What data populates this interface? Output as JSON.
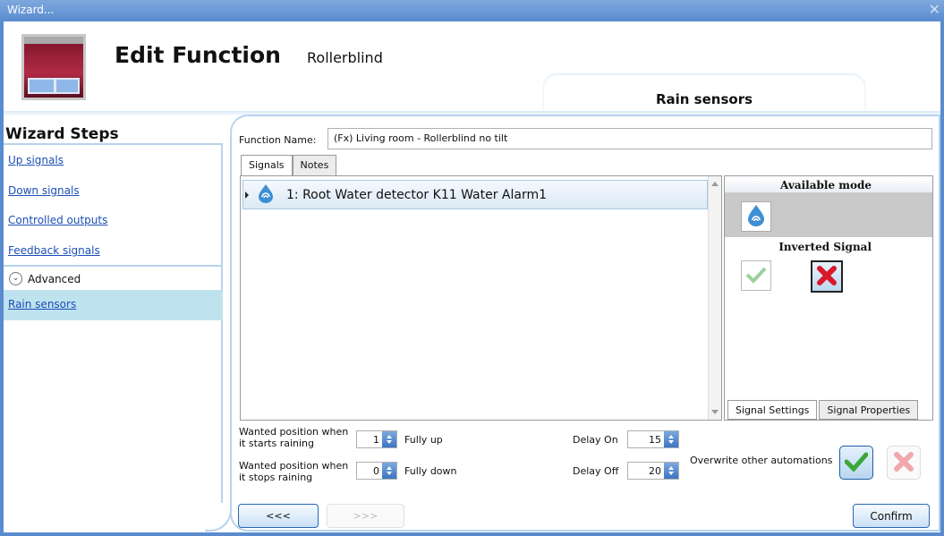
{
  "window": {
    "title": "Wizard...",
    "close_glyph": "✕"
  },
  "header": {
    "title": "Edit Function",
    "subtitle": "Rollerblind",
    "step_title": "Rain sensors"
  },
  "sidebar": {
    "heading": "Wizard Steps",
    "items": [
      {
        "label": "Up signals"
      },
      {
        "label": "Down signals"
      },
      {
        "label": "Controlled outputs"
      },
      {
        "label": "Feedback signals"
      }
    ],
    "advanced_label": "Advanced",
    "selected_item": "Rain sensors"
  },
  "form": {
    "function_name_label": "Function Name:",
    "function_name_value": "(Fx) Living room - Rollerblind no tilt",
    "tabs": [
      "Signals",
      "Notes"
    ],
    "signals": [
      {
        "label": "1: Root Water detector K11 Water Alarm1",
        "icon": "water-drop-icon"
      }
    ]
  },
  "side_panel": {
    "available_mode_label": "Available mode",
    "inverted_signal_label": "Inverted Signal",
    "tabs": [
      "Signal Settings",
      "Signal Properties"
    ]
  },
  "settings": {
    "start_label_1": "Wanted position when",
    "start_label_2": "it starts raining",
    "start_value": "1",
    "start_text": "Fully up",
    "stop_label_1": "Wanted position when",
    "stop_label_2": "it stops raining",
    "stop_value": "0",
    "stop_text": "Fully down",
    "delay_on_label": "Delay On",
    "delay_on_value": "15",
    "delay_off_label": "Delay Off",
    "delay_off_value": "20",
    "overwrite_label": "Overwrite other automations"
  },
  "nav": {
    "prev_label": "<<<",
    "next_label": ">>>",
    "confirm_label": "Confirm"
  },
  "colors": {
    "titlebar": "#5a8bcf",
    "accent": "#2a68b5",
    "selected_row": "#bfe2ef",
    "confirm_red": "#d9182b",
    "ok_green": "#3aa73a"
  }
}
